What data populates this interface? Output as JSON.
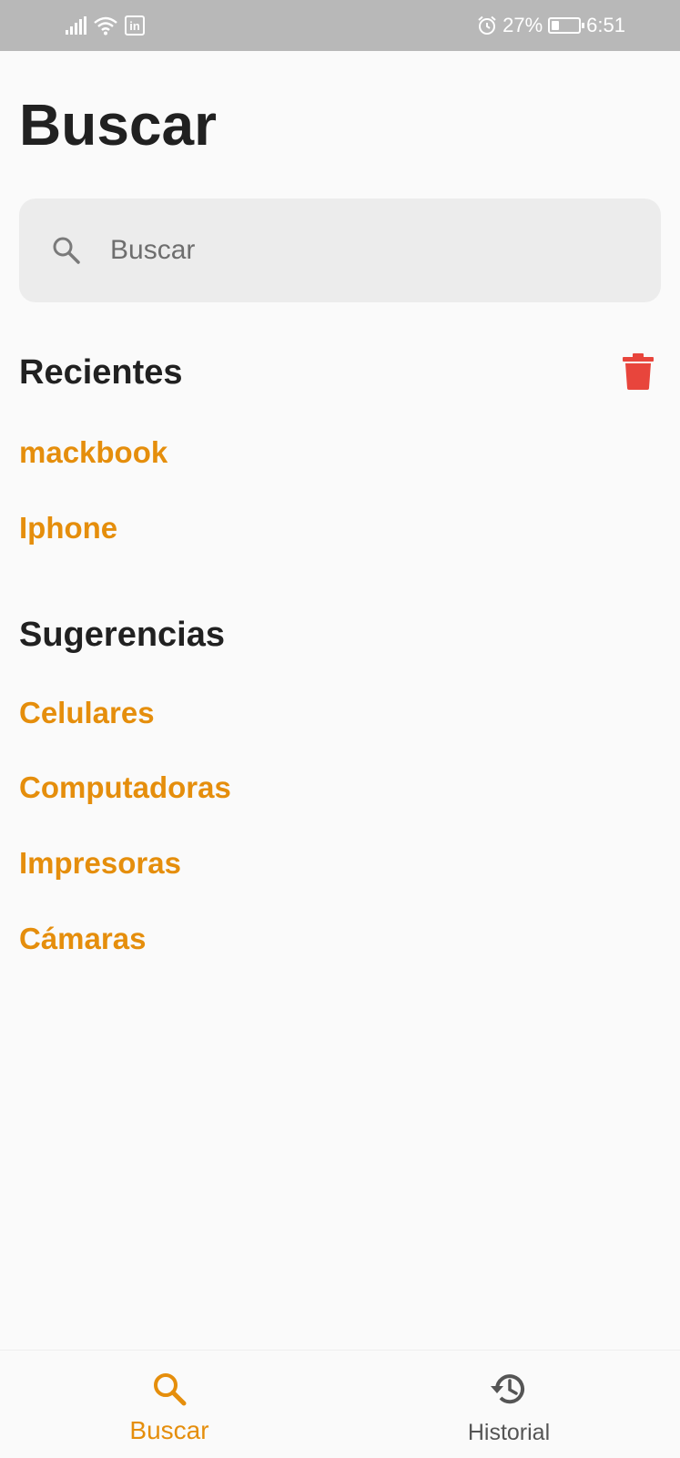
{
  "status_bar": {
    "linkedin_glyph": "in",
    "battery_percent": "27%",
    "battery_level": 0.27,
    "time": "6:51",
    "icons": [
      "signal-icon",
      "wifi-icon",
      "linkedin-icon",
      "alarm-icon",
      "battery-icon"
    ]
  },
  "page": {
    "title": "Buscar"
  },
  "search": {
    "placeholder": "Buscar",
    "value": ""
  },
  "recent": {
    "title": "Recientes",
    "items": [
      "mackbook",
      "Iphone"
    ],
    "clear_icon": "trash-icon"
  },
  "suggestions": {
    "title": "Sugerencias",
    "items": [
      "Celulares",
      "Computadoras",
      "Impresoras",
      "Cámaras"
    ]
  },
  "bottom_nav": {
    "items": [
      {
        "label": "Buscar",
        "icon": "search-icon",
        "active": true
      },
      {
        "label": "Historial",
        "icon": "history-icon",
        "active": false
      }
    ]
  },
  "colors": {
    "accent": "#e58e0c",
    "danger": "#e8453c",
    "status_bar": "#b8b8b8",
    "title": "#212121",
    "inactive": "#555555"
  }
}
